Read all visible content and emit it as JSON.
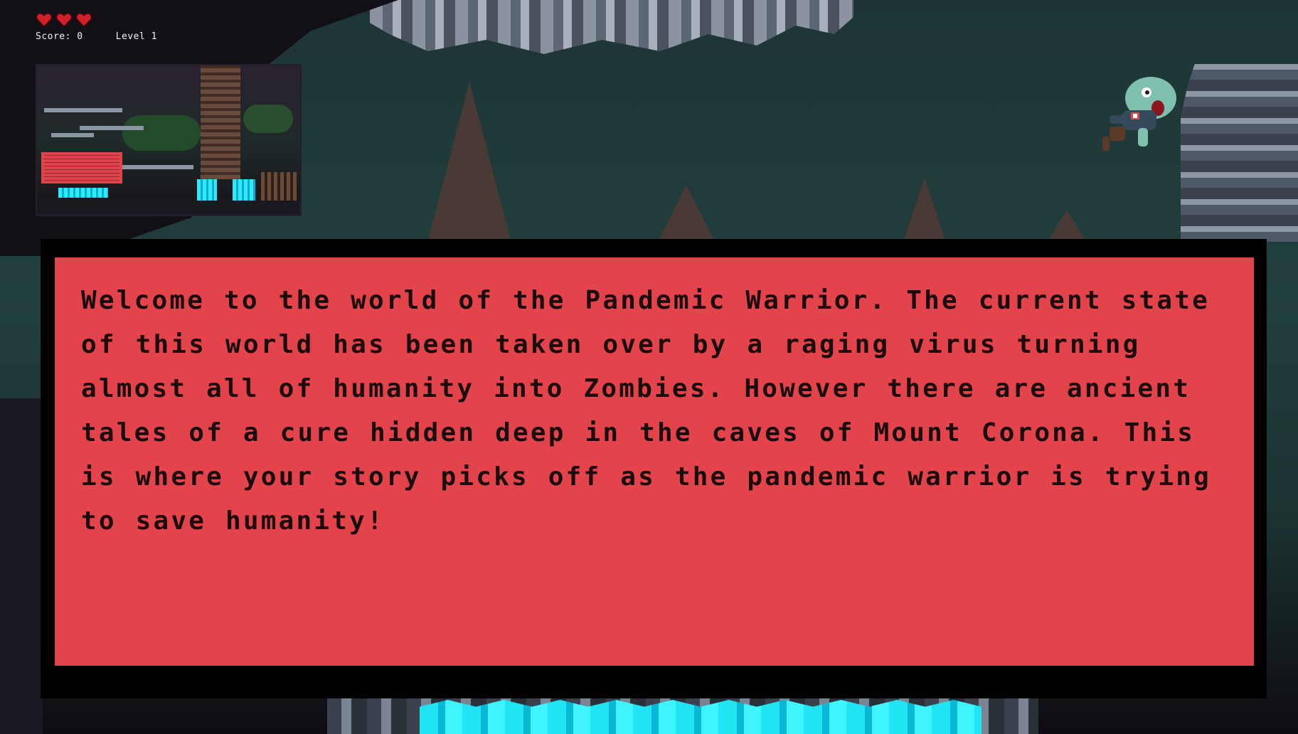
{
  "hud": {
    "lives": 3,
    "score_label": "Score: 0",
    "level_label": "Level 1",
    "heart_icon": "heart-icon",
    "heart_color": "#d31f2a"
  },
  "minimap": {
    "label": ""
  },
  "dialog": {
    "text": "Welcome to the world of the Pandemic Warrior. The current state of this world has been taken over by a raging virus turning almost all of humanity into Zombies. However there are ancient tales of a cure hidden deep in the caves of Mount Corona. This is where your story picks off as the pandemic warrior is trying to save humanity!",
    "panel_color": "#e3434b",
    "frame_color": "#000000"
  },
  "enemy": {
    "icon": "zombie-icon"
  },
  "colors": {
    "water": "#21e4f2",
    "cave": "#1d3535"
  }
}
